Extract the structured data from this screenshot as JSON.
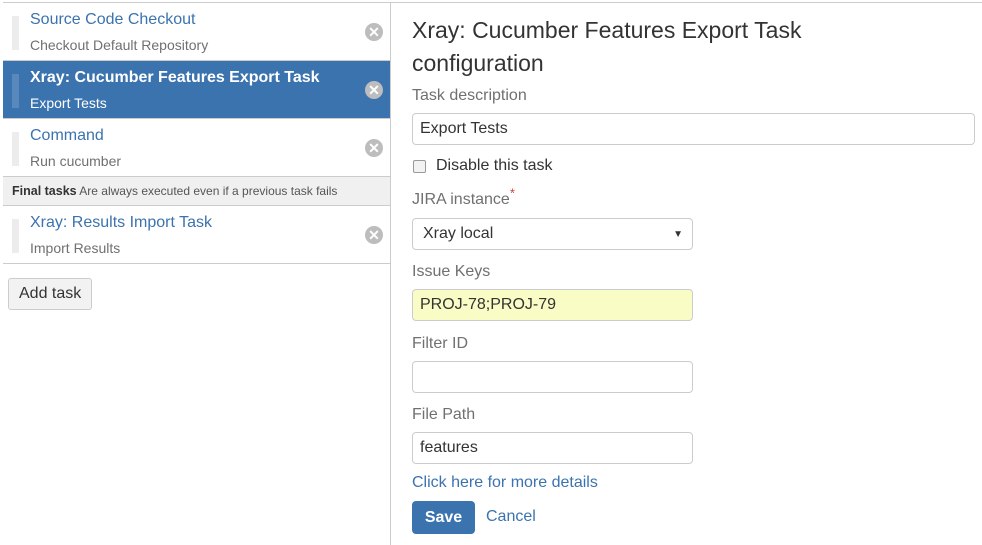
{
  "tasks": [
    {
      "title": "Source Code Checkout",
      "description": "Checkout Default Repository",
      "active": false
    },
    {
      "title": "Xray: Cucumber Features Export Task",
      "description": "Export Tests",
      "active": true
    },
    {
      "title": "Command",
      "description": "Run cucumber",
      "active": false
    }
  ],
  "final_tasks": {
    "header_bold": "Final tasks",
    "header_note": "Are always executed even if a previous task fails",
    "items": [
      {
        "title": "Xray: Results Import Task",
        "description": "Import Results"
      }
    ]
  },
  "add_task_label": "Add task",
  "remove_icon_glyph": "✕",
  "config": {
    "heading": "Xray: Cucumber Features Export Task configuration",
    "task_description_label": "Task description",
    "task_description_value": "Export Tests",
    "disable_label": "Disable this task",
    "disable_checked": false,
    "jira_instance_label": "JIRA instance",
    "required_marker": "*",
    "jira_instance_value": "Xray local",
    "dropdown_arrow": "▼",
    "issue_keys_label": "Issue Keys",
    "issue_keys_value": "PROJ-78;PROJ-79",
    "filter_id_label": "Filter ID",
    "filter_id_value": "",
    "file_path_label": "File Path",
    "file_path_value": "features",
    "details_link": "Click here for more details",
    "save_label": "Save",
    "cancel_label": "Cancel"
  },
  "colors": {
    "accent": "#3b73af",
    "highlight_field": "#fafcc6",
    "required": "#d04437"
  }
}
